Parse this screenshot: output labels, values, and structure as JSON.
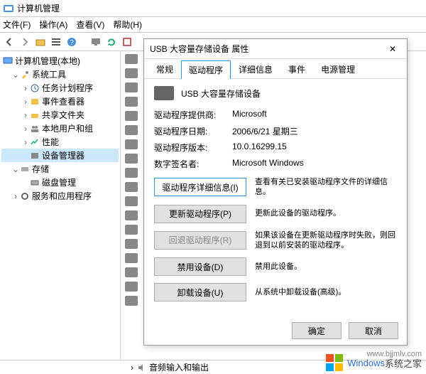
{
  "window": {
    "title": "计算机管理"
  },
  "menu": {
    "file": "文件(F)",
    "action": "操作(A)",
    "view": "查看(V)",
    "help": "帮助(H)"
  },
  "tree": {
    "root": "计算机管理(本地)",
    "system_tools": "系统工具",
    "task_scheduler": "任务计划程序",
    "event_viewer": "事件查看器",
    "shared_folders": "共享文件夹",
    "local_users": "本地用户和组",
    "performance": "性能",
    "device_manager": "设备管理器",
    "storage": "存储",
    "disk_mgmt": "磁盘管理",
    "services_apps": "服务和应用程序"
  },
  "dialog": {
    "title": "USB 大容量存储设备 属性",
    "tabs": {
      "general": "常规",
      "driver": "驱动程序",
      "details": "详细信息",
      "events": "事件",
      "power": "电源管理"
    },
    "device_name": "USB 大容量存储设备",
    "info": {
      "provider_k": "驱动程序提供商:",
      "provider_v": "Microsoft",
      "date_k": "驱动程序日期:",
      "date_v": "2006/6/21 星期三",
      "version_k": "驱动程序版本:",
      "version_v": "10.0.16299.15",
      "signer_k": "数字签名者:",
      "signer_v": "Microsoft Windows"
    },
    "buttons": {
      "details": "驱动程序详细信息(I)",
      "details_desc": "查看有关已安装驱动程序文件的详细信息。",
      "update": "更新驱动程序(P)",
      "update_desc": "更新此设备的驱动程序。",
      "rollback": "回退驱动程序(R)",
      "rollback_desc": "如果该设备在更新驱动程序时失败，则回退到以前安装的驱动程序。",
      "disable": "禁用设备(D)",
      "disable_desc": "禁用此设备。",
      "uninstall": "卸载设备(U)",
      "uninstall_desc": "从系统中卸载设备(高级)。"
    },
    "ok": "确定",
    "cancel": "取消"
  },
  "bottom": {
    "left_item": "音频输入和输出"
  },
  "watermark": {
    "brand": "Windows",
    "suffix": "系统之家",
    "url": "www.bjjmlv.com"
  }
}
